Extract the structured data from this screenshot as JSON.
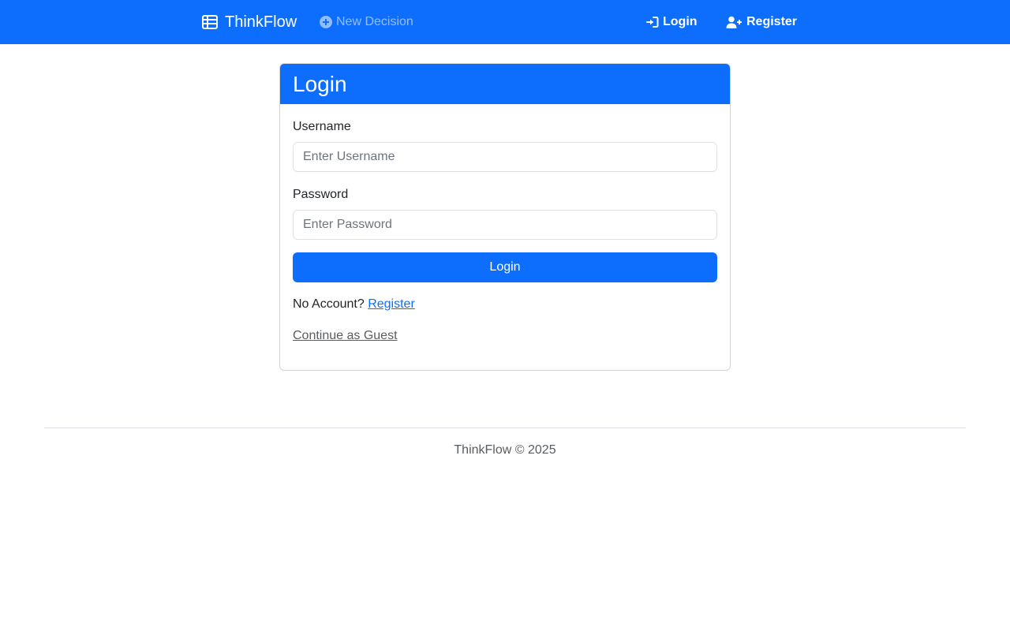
{
  "navbar": {
    "brand": "ThinkFlow",
    "brand_icon": "table-icon",
    "new_decision": "New Decision",
    "new_decision_icon": "plus-circle-icon",
    "login": "Login",
    "login_icon": "sign-in-icon",
    "register": "Register",
    "register_icon": "user-plus-icon",
    "color": "#0d6efd"
  },
  "login_card": {
    "title": "Login",
    "username_label": "Username",
    "username_placeholder": "Enter Username",
    "username_value": "",
    "password_label": "Password",
    "password_placeholder": "Enter Password",
    "password_value": "",
    "submit_label": "Login",
    "no_account_text": "No Account?",
    "register_link": "Register",
    "guest_link": "Continue as Guest"
  },
  "footer": {
    "text": "ThinkFlow © 2025"
  }
}
